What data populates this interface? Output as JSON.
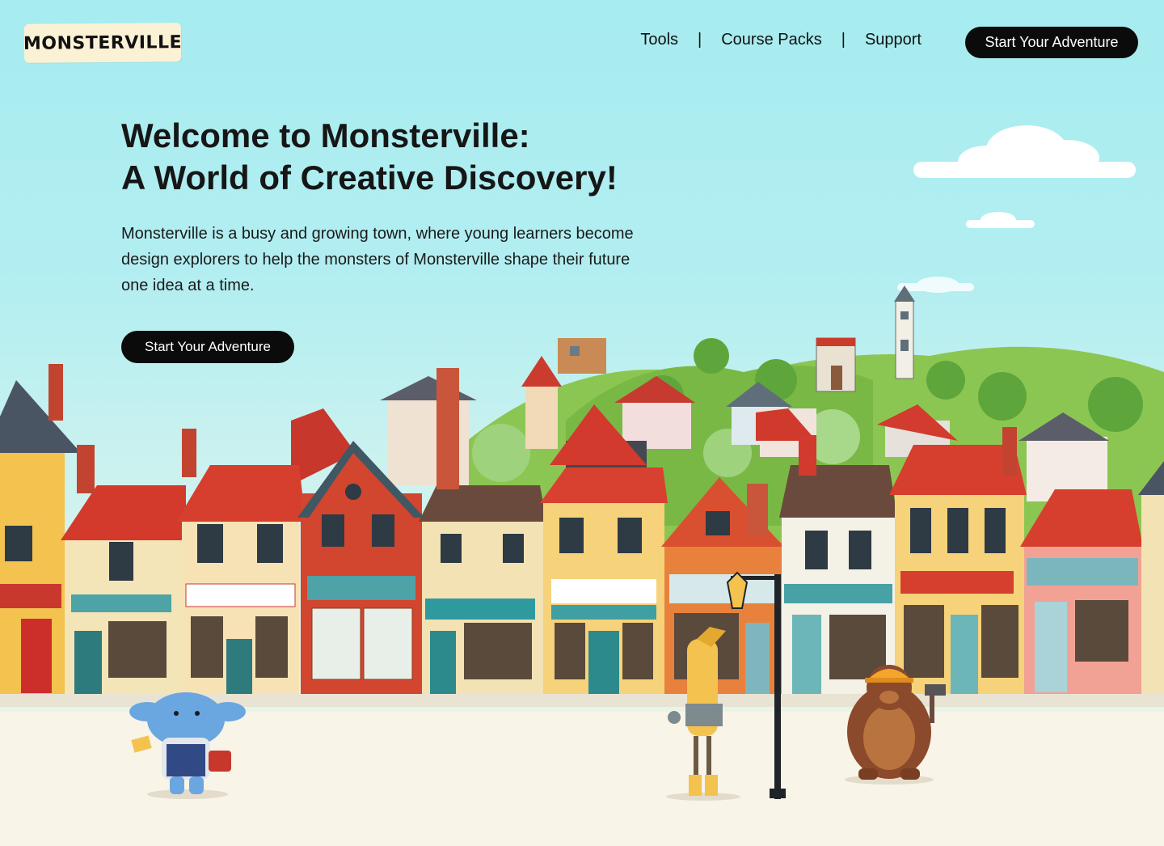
{
  "header": {
    "logo_text": "MONSTERVILLE",
    "nav": [
      "Tools",
      "Course Packs",
      "Support"
    ],
    "cta_label": "Start Your Adventure"
  },
  "hero": {
    "title_line1": "Welcome to Monsterville:",
    "title_line2": "A World of Creative Discovery!",
    "text": "Monsterville is a busy and growing town, where young learners become design explorers to help the monsters of Monsterville shape their future one idea at a time.",
    "cta_label": "Start Your Adventure"
  },
  "illustration": {
    "subject": "town-street-scene",
    "colors": {
      "sky": "#a6ecf0",
      "hills": "#8cc652",
      "ground": "#faf3e4",
      "roof_red": "#d9392c",
      "wall_yellow": "#f6d27a"
    }
  }
}
